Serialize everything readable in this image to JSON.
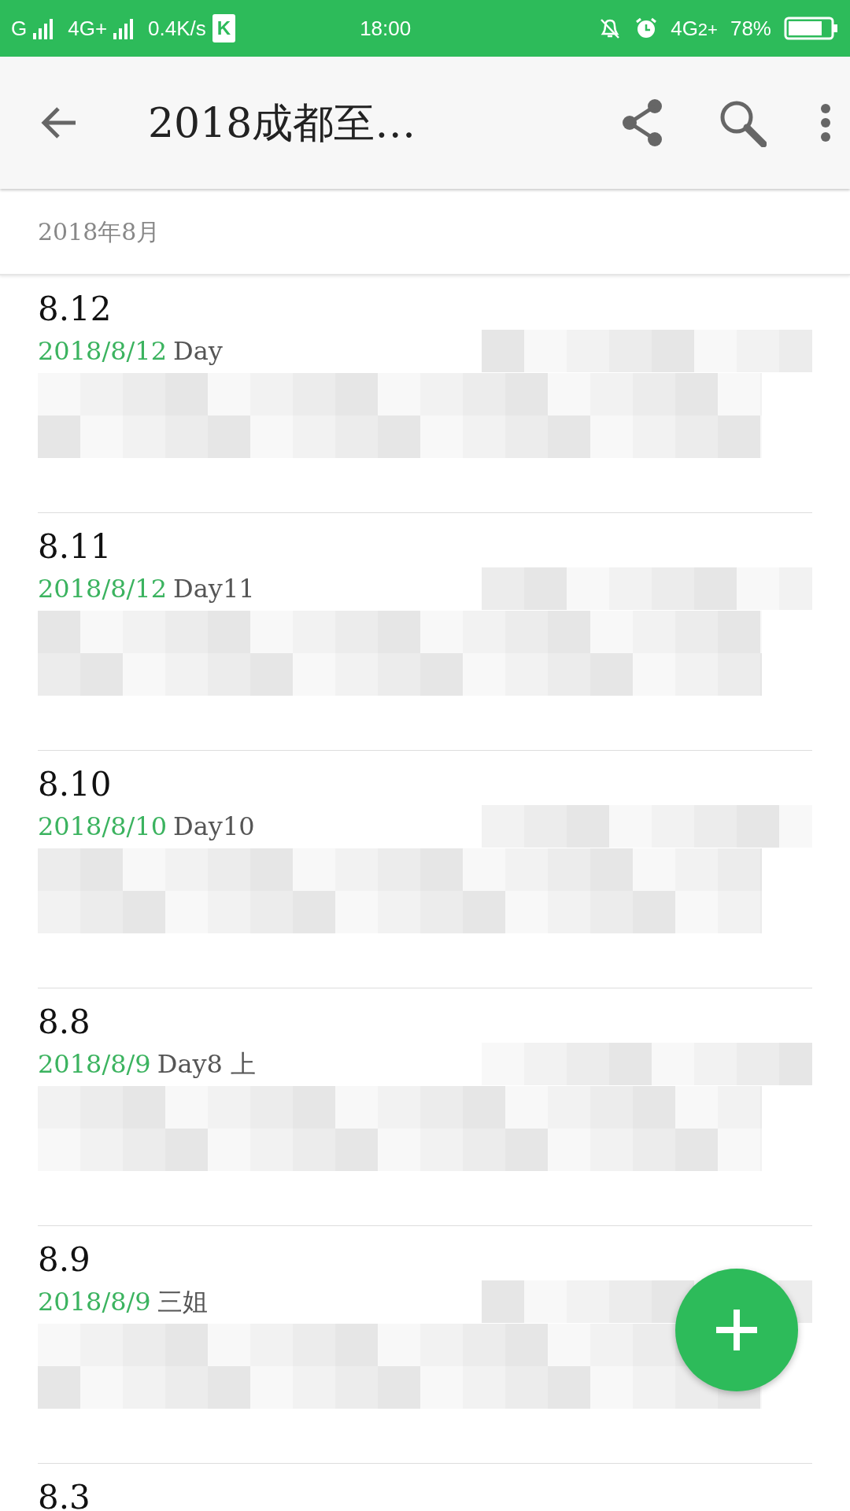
{
  "status_bar": {
    "carrier": "G",
    "network_1": "4G+",
    "speed": "0.4K/s",
    "app_badge": "K",
    "time": "18:00",
    "network_2": "4G",
    "network_2_sub": "2+",
    "battery": "78%"
  },
  "toolbar": {
    "title": "2018成都至…"
  },
  "section": {
    "title": "2018年8月"
  },
  "notes": [
    {
      "title": "8.12",
      "date": "2018/8/12",
      "preview": "Day"
    },
    {
      "title": "8.11",
      "date": "2018/8/12",
      "preview": "Day11"
    },
    {
      "title": "8.10",
      "date": "2018/8/10",
      "preview": "Day10"
    },
    {
      "title": "8.8",
      "date": "2018/8/9",
      "preview": "Day8 上"
    },
    {
      "title": "8.9",
      "date": "2018/8/9",
      "preview": "三姐"
    },
    {
      "title": "8.3"
    }
  ]
}
